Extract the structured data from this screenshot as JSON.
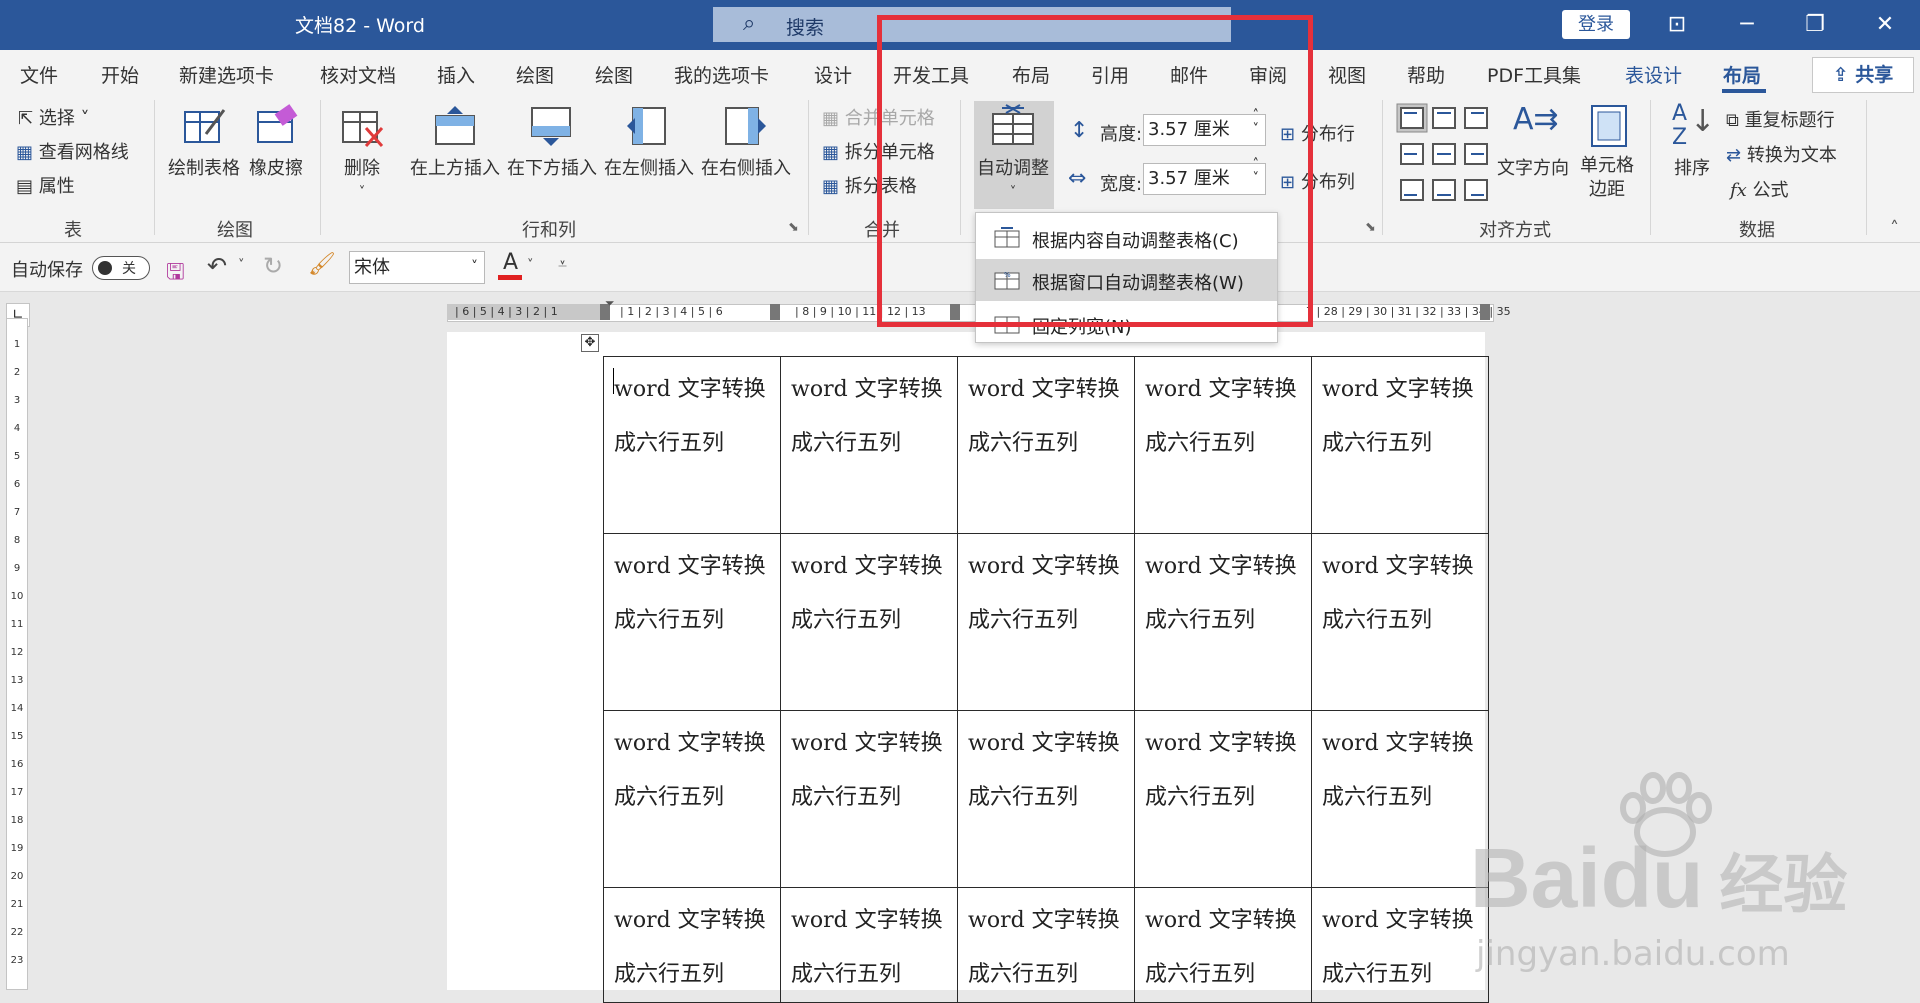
{
  "titlebar": {
    "title": "文档82  -  Word",
    "search_placeholder": "搜索",
    "login_label": "登录",
    "colors": {
      "bar": "#2b579a",
      "search": "#a8bcd9"
    }
  },
  "tabs": [
    "文件",
    "开始",
    "新建选项卡",
    "核对文档",
    "插入",
    "绘图",
    "绘图",
    "我的选项卡",
    "设计",
    "开发工具",
    "布局",
    "引用",
    "邮件",
    "审阅",
    "视图",
    "帮助",
    "PDF工具集",
    "表设计",
    "布局"
  ],
  "share_label": "共享",
  "ribbon": {
    "table": {
      "select": "选择",
      "gridlines": "查看网格线",
      "properties": "属性",
      "group": "表"
    },
    "draw": {
      "draw_table": "绘制表格",
      "eraser": "橡皮擦",
      "group": "绘图"
    },
    "rows_cols": {
      "delete": "删除",
      "insert_above": "在上方插入",
      "insert_below": "在下方插入",
      "insert_left": "在左侧插入",
      "insert_right": "在右侧插入",
      "group": "行和列"
    },
    "merge": {
      "merge_cells": "合并单元格",
      "split_cells": "拆分单元格",
      "split_table": "拆分表格",
      "group": "合并"
    },
    "cell_size": {
      "autofit": "自动调整",
      "height_label": "高度:",
      "height_value": "3.57 厘米",
      "width_label": "宽度:",
      "width_value": "3.57 厘米",
      "distribute_rows": "分布行",
      "distribute_cols": "分布列"
    },
    "alignment": {
      "text_direction": "文字方向",
      "cell_margins_1": "单元格",
      "cell_margins_2": "边距",
      "group": "对齐方式"
    },
    "data": {
      "sort": "排序",
      "repeat_header": "重复标题行",
      "convert_text": "转换为文本",
      "formula": "公式",
      "group": "数据"
    }
  },
  "qat": {
    "autosave": "自动保存",
    "toggle_state": "关",
    "font": "宋体"
  },
  "autofit_menu": {
    "items": [
      {
        "label": "根据内容自动调整表格(C)"
      },
      {
        "label": "根据窗口自动调整表格(W)",
        "highlighted": true
      },
      {
        "label": "固定列宽(N)"
      }
    ]
  },
  "ruler": {
    "left_numbers": "| 6 | 5 | 4 | 3 | 2 | 1",
    "mid_numbers": "| 1 | 2 | 3 | 4 | 5 | 6",
    "mid2_numbers": "| 8 | 9 | 10 | 11 | 12 | 13",
    "right_numbers": "7 | 28 | 29 | 30 | 31 | 32 | 33 | 34 | 35",
    "v_numbers": [
      "1",
      "2",
      "3",
      "4",
      "5",
      "6",
      "7",
      "8",
      "9",
      "10",
      "11",
      "12",
      "13",
      "14",
      "15",
      "16",
      "17",
      "18",
      "19",
      "20",
      "21",
      "22",
      "23"
    ]
  },
  "table_cell_text": {
    "line1": "word 文字转换",
    "line2": "成六行五列"
  },
  "watermark": {
    "brand": "Baidu",
    "product": "经验",
    "url": "jingyan.baidu.com"
  }
}
